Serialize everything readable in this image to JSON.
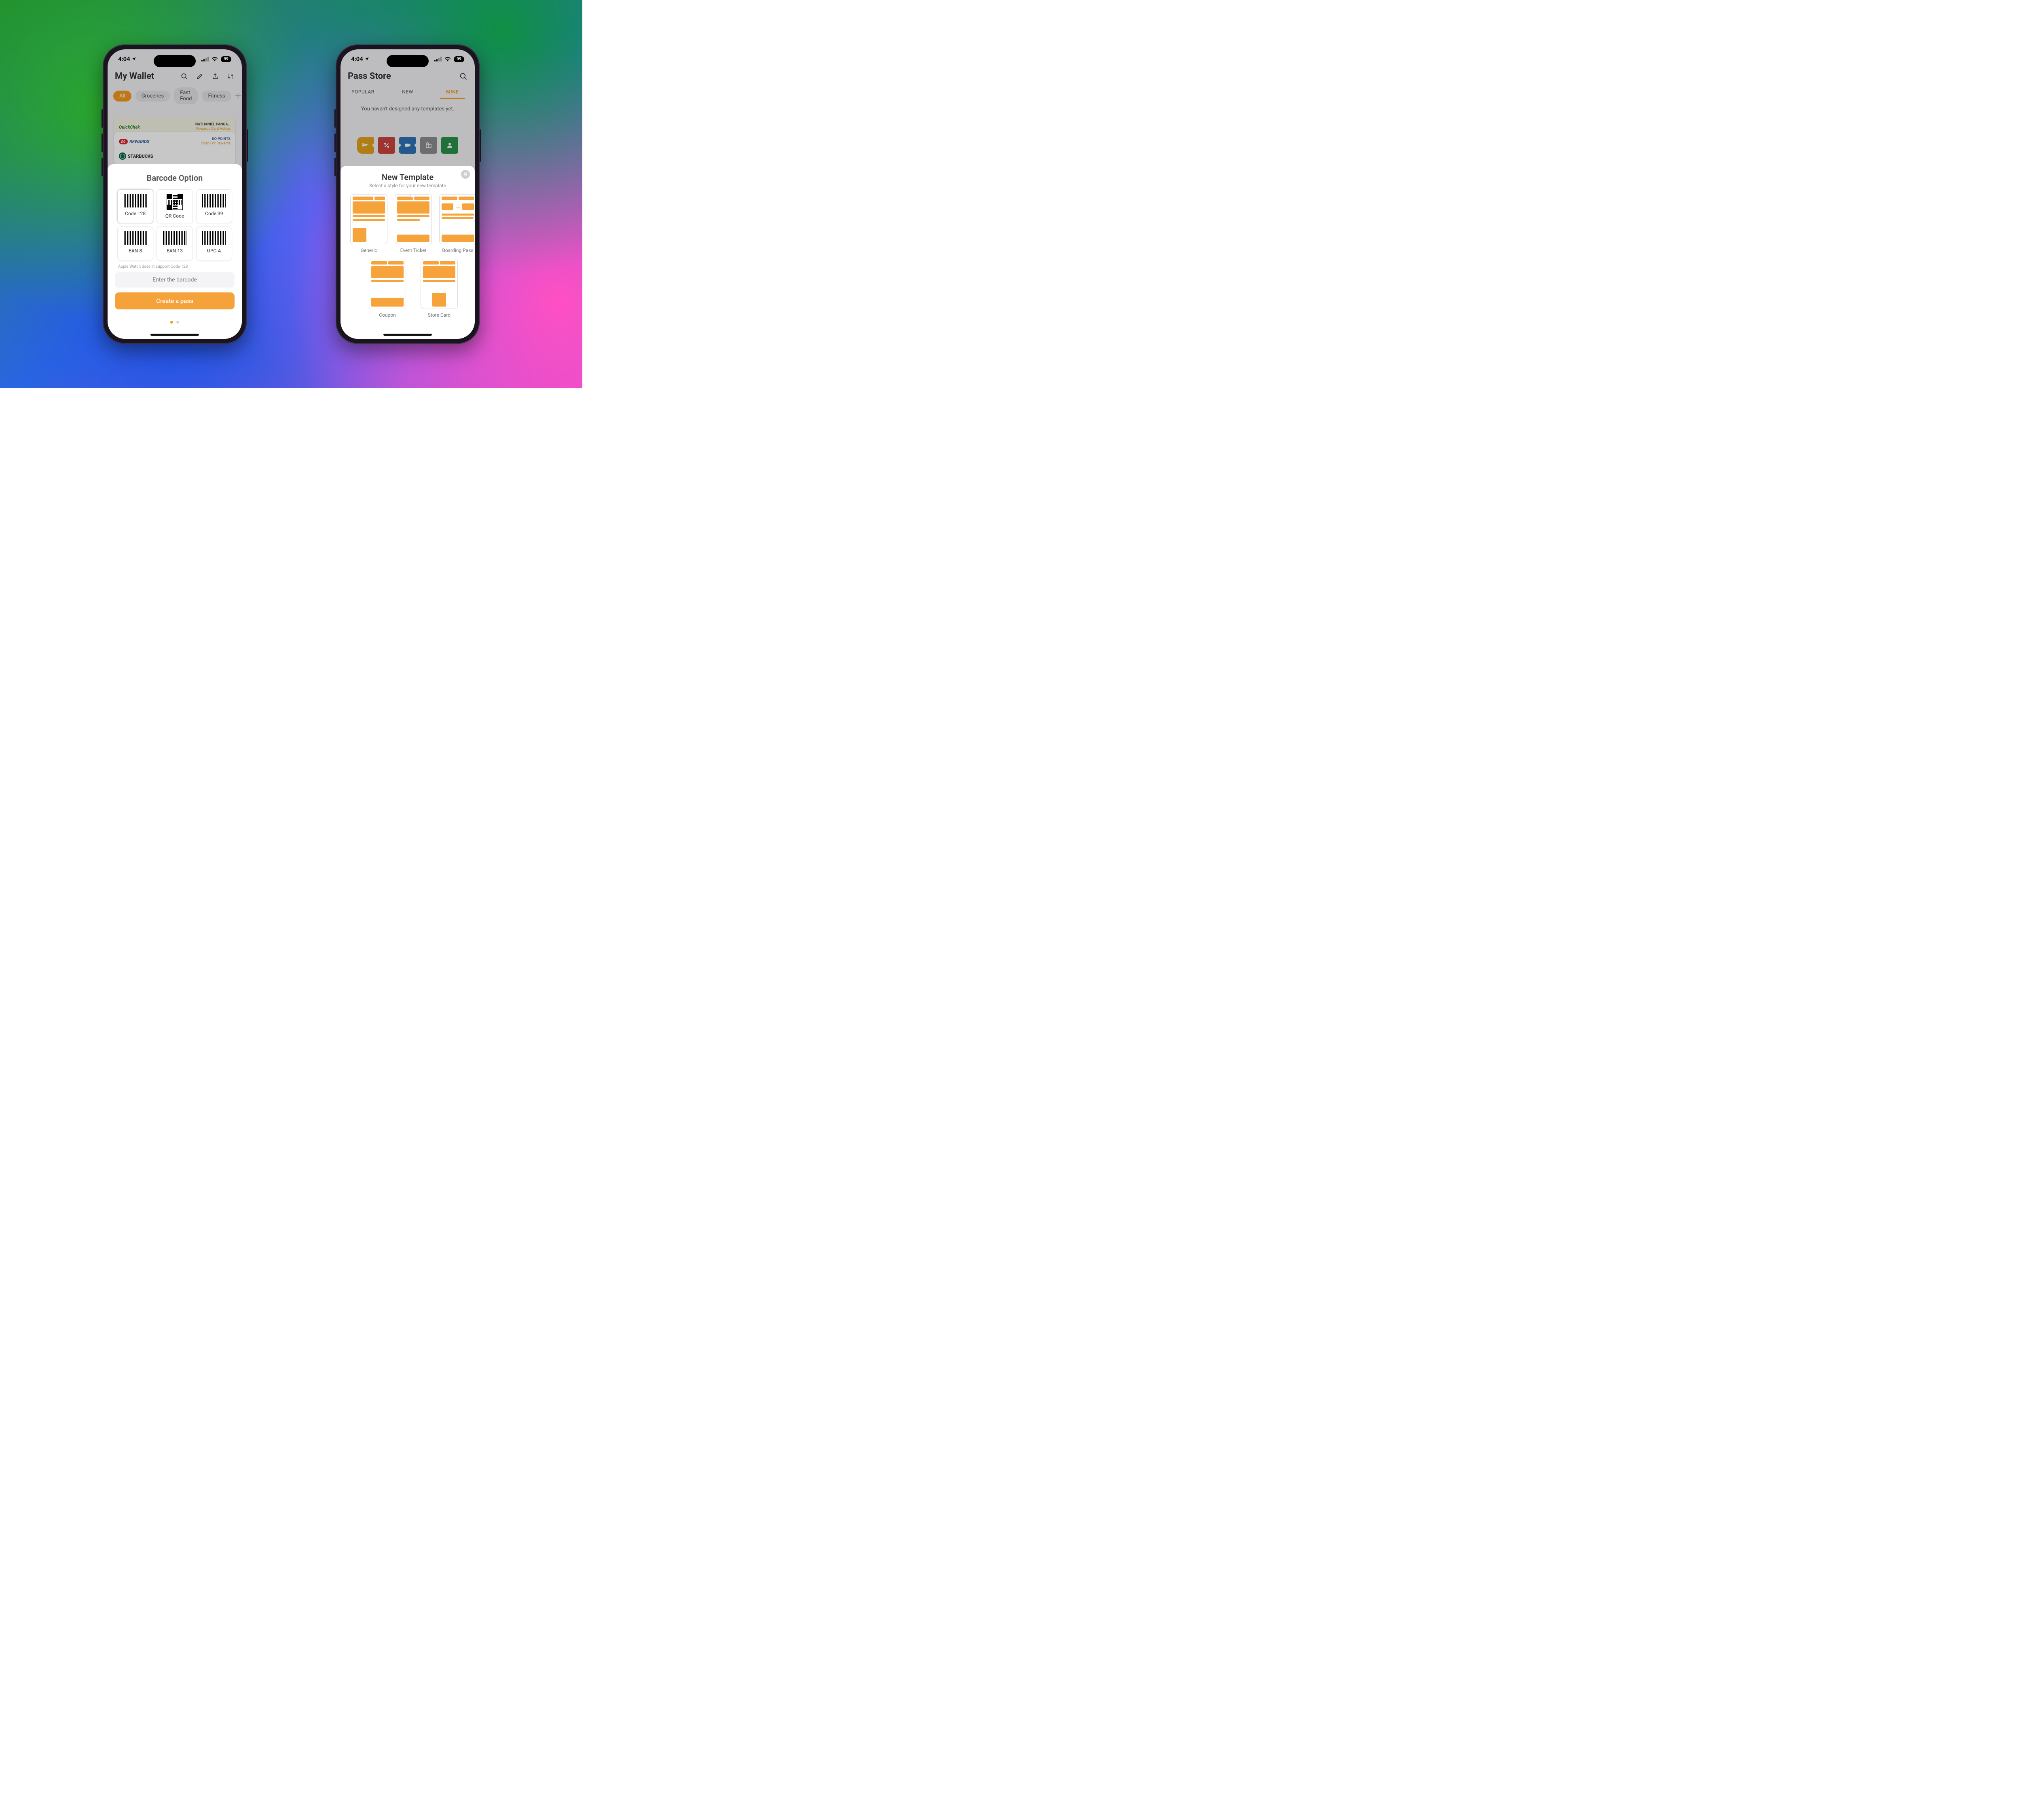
{
  "status": {
    "time": "4:04",
    "battery": "99"
  },
  "left": {
    "title": "My Wallet",
    "chips": {
      "all": "All",
      "g": "Groceries",
      "f": "Fast Food",
      "fit": "Fitness"
    },
    "cards": {
      "quickchek": {
        "brand": "QuickChek",
        "name": "NATHANIEL PANGA…",
        "sub": "Rewards Card Holder"
      },
      "dq": {
        "brand": "REWARDS",
        "name": "DQ POINTS",
        "sub": "Scan For Rewards"
      },
      "starbucks": {
        "brand": "STARBUCKS"
      }
    },
    "sheet": {
      "title": "Barcode Option",
      "opts": {
        "c128": "Code 128",
        "qr": "QR Code",
        "c39": "Code 39",
        "ean8": "EAN-8",
        "ean13": "EAN-13",
        "upca": "UPC-A"
      },
      "note": "Apple Watch doesn't support Code 128",
      "placeholder": "Enter the barcode",
      "cta": "Create a pass"
    }
  },
  "right": {
    "title": "Pass Store",
    "tabs": {
      "popular": "POPULAR",
      "new": "NEW",
      "mine": "MINE"
    },
    "empty": "You haven't designed any templates yet.",
    "sheet": {
      "title": "New Template",
      "sub": "Select a style for your new template",
      "types": {
        "generic": "Generic",
        "event": "Event Ticket",
        "boarding": "Boarding Pass",
        "coupon": "Coupon",
        "store": "Store Card"
      }
    }
  }
}
